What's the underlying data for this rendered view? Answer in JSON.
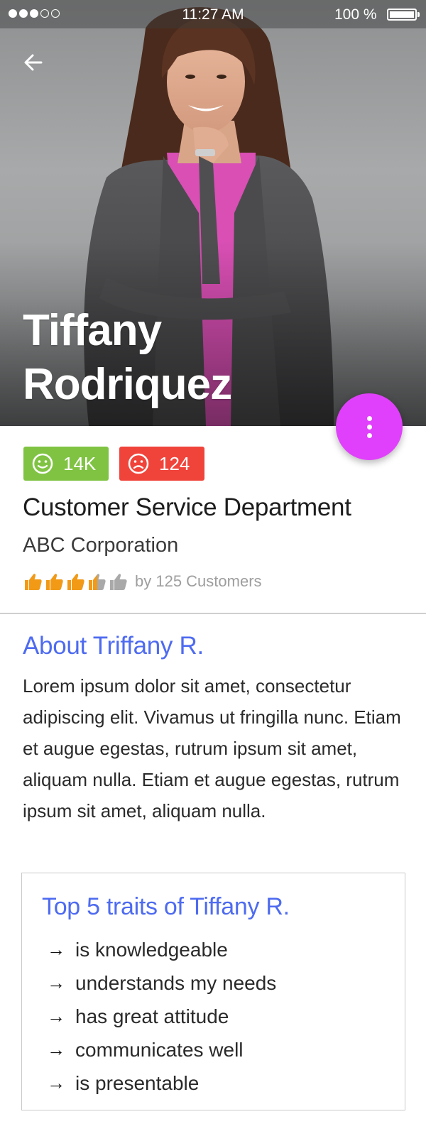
{
  "status_bar": {
    "time": "11:27 AM",
    "battery": "100 %"
  },
  "header": {
    "back_icon": "arrow-left-icon",
    "first_name": "Tiffany",
    "last_name": "Rodriquez",
    "menu_icon": "more-vertical-icon",
    "fab_color": "#e040fb"
  },
  "stats": {
    "positive": "14K",
    "negative": "124",
    "positive_color": "#80c343",
    "negative_color": "#f0433a"
  },
  "profile": {
    "department": "Customer Service Department",
    "company": "ABC Corporation",
    "rating": 3.5,
    "rating_max": 5,
    "rating_text": "by 125 Customers"
  },
  "about": {
    "title": "About Triffany R.",
    "body": "Lorem ipsum dolor sit amet, consectetur adipiscing elit. Vivamus ut fringilla nunc. Etiam et augue egestas, rutrum ipsum sit amet, aliquam nulla. Etiam et augue egestas, rutrum ipsum sit amet, aliquam nulla."
  },
  "traits": {
    "title": "Top 5 traits of Tiffany R.",
    "arrow": "→",
    "items": [
      "is knowledgeable",
      "understands my needs",
      "has great attitude",
      "communicates well",
      "is presentable"
    ]
  },
  "accent_color": "#4e6bf0"
}
